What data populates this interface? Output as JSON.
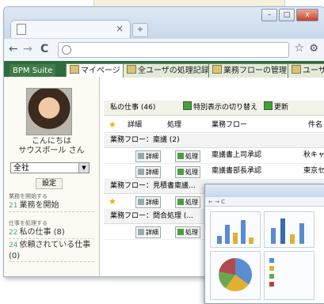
{
  "browser": {
    "tab_x": "×",
    "new_tab": "+",
    "nav": {
      "back": "←",
      "forward": "→",
      "reload": "C"
    },
    "star": "☆",
    "wrench": "🔧"
  },
  "app": {
    "tabs": [
      {
        "label": "BPM Suite"
      },
      {
        "label": "マイページ"
      },
      {
        "label": "全ユーザの処理記録"
      },
      {
        "label": "業務フローの管理"
      },
      {
        "label": "ユーザ"
      }
    ]
  },
  "sidebar": {
    "greeting_line1": "こんにちは",
    "greeting_line2": "サウスポール さん",
    "filter_value": "全社",
    "settings_label": "設定",
    "section_start": "業務を開始する",
    "start_link": "業務を開始",
    "section_tasks": "仕事を処理する",
    "my_tasks": "私の仕事 (8)",
    "delegated_tasks": "依頼されている仕事(0)",
    "num_start": "21",
    "num_my": "22",
    "num_del": "24"
  },
  "main": {
    "title": "私の仕事 (46)",
    "toggle_label": "特別表示の切り替え",
    "refresh_label": "更新",
    "columns": {
      "detail": "詳細",
      "process": "処理",
      "flow": "業務フロー",
      "subject": "件名"
    },
    "groups": [
      {
        "label": "業務フロー：稟議 (2)"
      },
      {
        "label": "業務フロー：見積書稟議..."
      },
      {
        "label": "業務フロー：問合処理 (..."
      }
    ],
    "rows": [
      {
        "detail": "詳細",
        "process": "処理",
        "flow": "稟議書上司承認",
        "subject": "秋キャ"
      },
      {
        "detail": "詳細",
        "process": "処理",
        "flow": "稟議書部長承認",
        "subject": "東京セ"
      },
      {
        "detail": "詳細",
        "process": "処理",
        "flow": "",
        "subject": ""
      },
      {
        "detail": "詳細",
        "process": "処理",
        "flow": "",
        "subject": ""
      }
    ],
    "star": "★"
  },
  "inset": {
    "nav": "← → C"
  }
}
